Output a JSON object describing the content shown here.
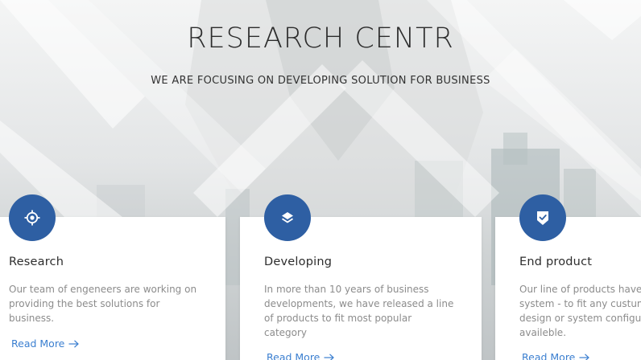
{
  "hero": {
    "title": "RESEARCH CENTR",
    "subtitle": "WE ARE FOCUSING ON DEVELOPING SOLUTION FOR BUSINESS"
  },
  "accent_color": "#2e5fa3",
  "link_color": "#3b7fd0",
  "cards": [
    {
      "icon": "target-icon",
      "title": "Research",
      "text": "Our team of engeneers are working on\nproviding the best solutions for\nbusiness.",
      "link": "Read More"
    },
    {
      "icon": "layers-icon",
      "title": "Developing",
      "text": "In more than 10 years of business\ndevelopments, we have released a line\nof products to fit most popular\ncategory",
      "link": "Read More"
    },
    {
      "icon": "shield-check-icon",
      "title": "End product",
      "text": "Our line of products have\nsystem - to fit any custum\ndesign or system configu\navaileble.",
      "link": "Read More"
    }
  ]
}
